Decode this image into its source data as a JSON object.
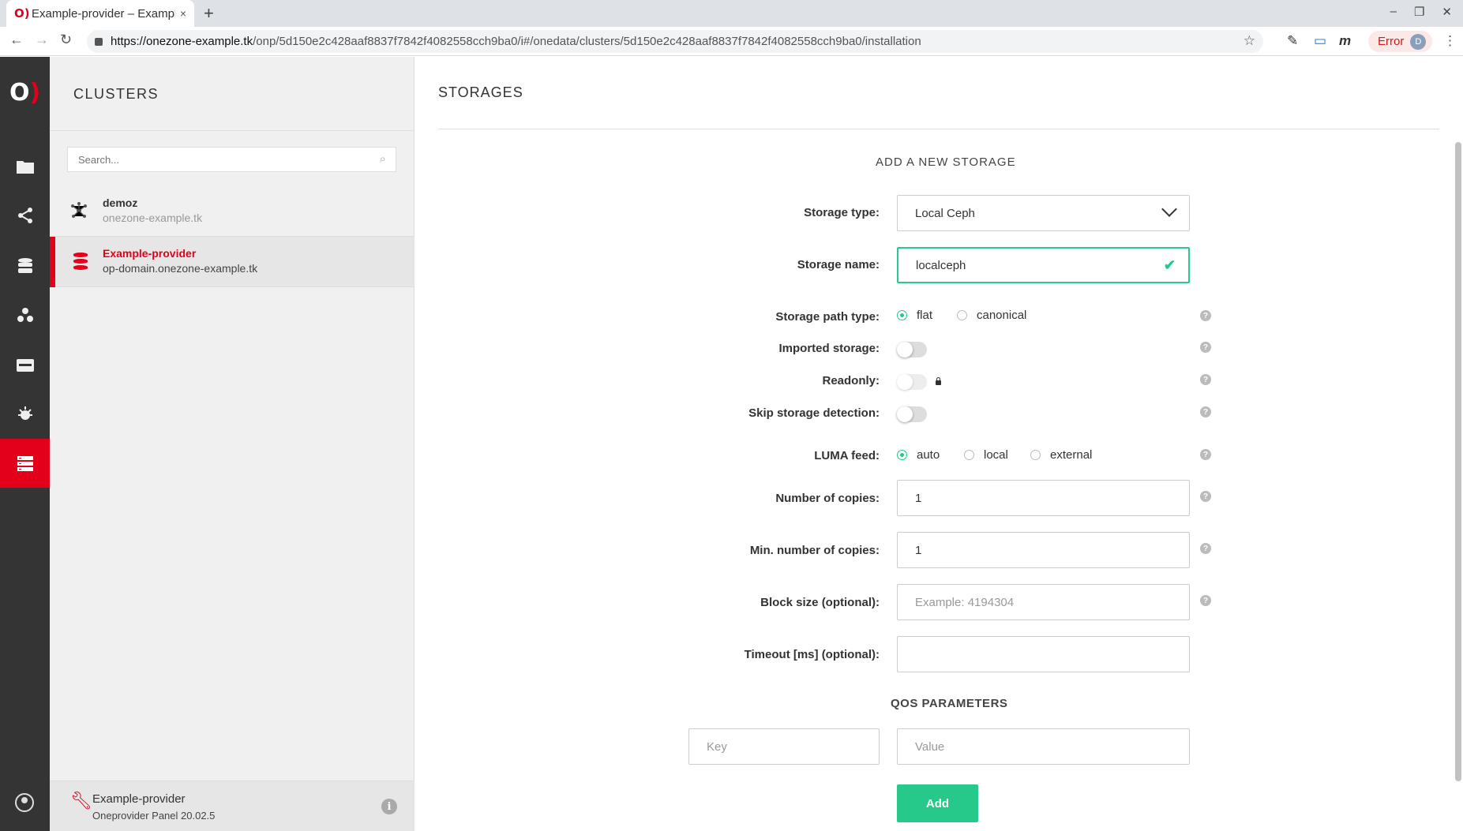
{
  "browser": {
    "tab_favicon": "O)",
    "tab_title": "Example-provider – Example",
    "tab_close": "×",
    "new_tab": "+",
    "win_minimize": "–",
    "win_maximize": "❐",
    "win_close": "✕",
    "url_host": "https://onezone-example.tk",
    "url_path": "/onp/5d150e2c428aaf8837f7842f4082558cch9ba0/i#/onedata/clusters/5d150e2c428aaf8837f7842f4082558cch9ba0/installation",
    "error_label": "Error",
    "profile_initial": "D",
    "ext_m": "m"
  },
  "rail": {
    "logo_o": "O",
    "logo_bracket": ")",
    "items": [
      {
        "icon": "folder-icon",
        "glyph": "▬"
      },
      {
        "icon": "share-icon",
        "glyph": "⋖"
      },
      {
        "icon": "database-icon",
        "glyph": "☰"
      },
      {
        "icon": "groups-icon",
        "glyph": "⁂"
      },
      {
        "icon": "tokens-icon",
        "glyph": "▭"
      },
      {
        "icon": "harvester-icon",
        "glyph": "✹"
      },
      {
        "icon": "clusters-icon",
        "glyph": "☰"
      }
    ]
  },
  "sidebar": {
    "title": "CLUSTERS",
    "search_placeholder": "Search...",
    "clusters": [
      {
        "name": "demoz",
        "domain": "onezone-example.tk"
      },
      {
        "name": "Example-provider",
        "domain": "op-domain.onezone-example.tk"
      }
    ],
    "footer": {
      "name": "Example-provider",
      "version": "Oneprovider Panel 20.02.5",
      "info": "i"
    }
  },
  "main": {
    "title": "STORAGES",
    "form_title": "ADD A NEW STORAGE",
    "labels": {
      "storage_type": "Storage type:",
      "storage_name": "Storage name:",
      "path_type": "Storage path type:",
      "imported": "Imported storage:",
      "readonly": "Readonly:",
      "skip_detection": "Skip storage detection:",
      "luma_feed": "LUMA feed:",
      "copies": "Number of copies:",
      "min_copies": "Min. number of copies:",
      "block_size": "Block size (optional):",
      "timeout": "Timeout [ms] (optional):"
    },
    "storage_type_value": "Local Ceph",
    "storage_name_value": "localceph",
    "path_type_options": [
      "flat",
      "canonical"
    ],
    "path_type_selected": "flat",
    "luma_options": [
      "auto",
      "local",
      "external"
    ],
    "luma_selected": "auto",
    "imported_storage": false,
    "readonly": false,
    "skip_detection": false,
    "copies_value": "1",
    "min_copies_value": "1",
    "block_size_placeholder": "Example: 4194304",
    "timeout_value": "",
    "qos_title": "QOS PARAMETERS",
    "qos_key_placeholder": "Key",
    "qos_value_placeholder": "Value",
    "add_button": "Add",
    "help_glyph": "?",
    "valid_glyph": "✔"
  },
  "colors": {
    "brand_red": "#e2001a",
    "valid_green": "#27c98a",
    "rail_bg": "#343434"
  }
}
